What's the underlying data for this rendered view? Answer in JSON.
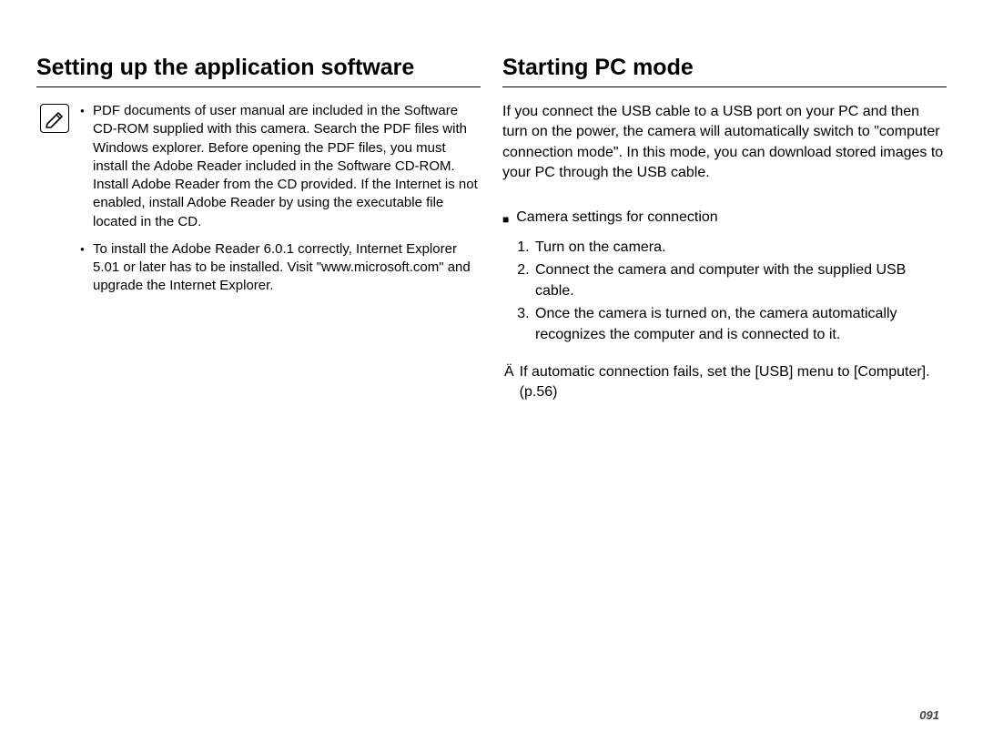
{
  "left": {
    "heading": "Setting up the application software",
    "bullets": [
      "PDF documents of user manual are included in the Software CD-ROM supplied with this camera. Search the PDF files with Windows explorer. Before opening the PDF files, you must install the Adobe Reader included in the Software CD-ROM. Install Adobe Reader from the CD provided. If the Internet is not enabled, install Adobe Reader by using the executable file located in the CD.",
      "To install the Adobe Reader 6.0.1 correctly, Internet Explorer 5.01 or later has to be installed. Visit \"www.microsoft.com\" and upgrade the Internet Explorer."
    ]
  },
  "right": {
    "heading": "Starting PC mode",
    "intro": "If you connect the USB cable to a USB port on your PC and then turn on the power, the camera will automatically switch to \"computer connection mode\". In this mode, you can download stored images to your PC through the USB cable.",
    "subheading": "Camera settings for connection",
    "steps": [
      "Turn on the camera.",
      "Connect the camera and computer with the supplied USB cable.",
      "Once the camera is turned on, the camera automatically recognizes the computer and is connected to it."
    ],
    "footnote_symbol": "Ä",
    "footnote": "If automatic connection fails, set the [USB] menu to [Computer]. (p.56)"
  },
  "page_number": "091"
}
